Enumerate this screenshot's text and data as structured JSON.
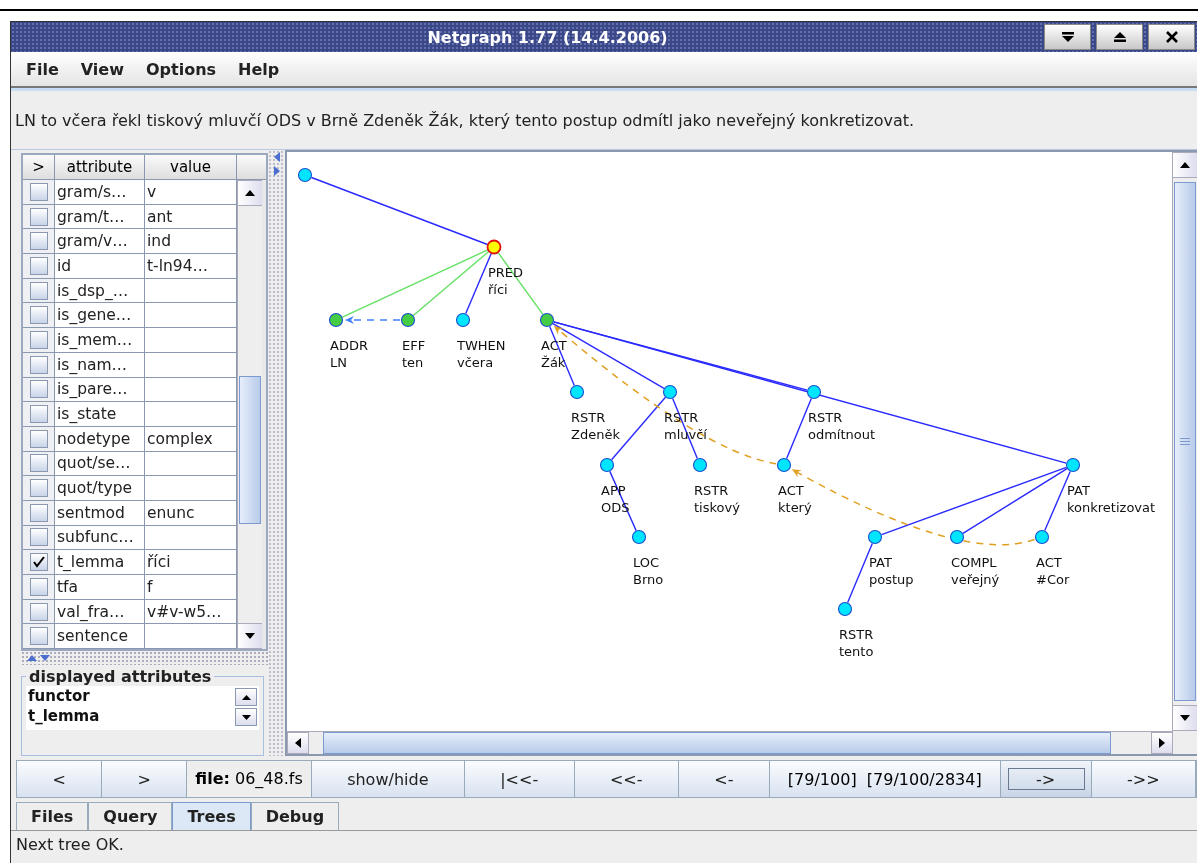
{
  "window": {
    "title": "Netgraph 1.77 (14.4.2006)"
  },
  "menu": [
    "File",
    "View",
    "Options",
    "Help"
  ],
  "sentence": "LN to včera řekl tiskový mluvčí ODS v Brně Zdeněk Žák, který tento postup odmítl jako neveřejný konkretizovat.",
  "attributes_table": {
    "columns": [
      ">",
      "attribute",
      "value"
    ],
    "rows": [
      {
        "checked": false,
        "attribute": "gram/s…",
        "value": "v"
      },
      {
        "checked": false,
        "attribute": "gram/t…",
        "value": "ant"
      },
      {
        "checked": false,
        "attribute": "gram/v…",
        "value": "ind"
      },
      {
        "checked": false,
        "attribute": "id",
        "value": "t-ln94…"
      },
      {
        "checked": false,
        "attribute": "is_dsp_…"
      },
      {
        "checked": false,
        "attribute": "is_gene…"
      },
      {
        "checked": false,
        "attribute": "is_mem…"
      },
      {
        "checked": false,
        "attribute": "is_nam…"
      },
      {
        "checked": false,
        "attribute": "is_pare…"
      },
      {
        "checked": false,
        "attribute": "is_state"
      },
      {
        "checked": false,
        "attribute": "nodetype",
        "value": "complex"
      },
      {
        "checked": false,
        "attribute": "quot/se…"
      },
      {
        "checked": false,
        "attribute": "quot/type"
      },
      {
        "checked": false,
        "attribute": "sentmod",
        "value": "enunc"
      },
      {
        "checked": false,
        "attribute": "subfunc…"
      },
      {
        "checked": true,
        "attribute": "t_lemma",
        "value": "říci"
      },
      {
        "checked": false,
        "attribute": "tfa",
        "value": "f"
      },
      {
        "checked": false,
        "attribute": "val_fra…",
        "value": "v#v-w5…"
      },
      {
        "checked": false,
        "attribute": "sentence"
      }
    ]
  },
  "displayed_attributes": {
    "title": "displayed attributes",
    "items": [
      "functor",
      "t_lemma"
    ]
  },
  "tree": {
    "root": {
      "color": "#00e5ff",
      "selected": false,
      "children": [
        {
          "functor": "PRED",
          "t_lemma": "říci",
          "color": "#ffff00",
          "selected": true,
          "edge": {
            "color": "#2a2aff"
          },
          "children": [
            {
              "functor": "ADDR",
              "t_lemma": "LN",
              "color": "#44cc44",
              "selected": false,
              "edge": {
                "color": "#66e066"
              }
            },
            {
              "functor": "EFF",
              "t_lemma": "ten",
              "color": "#44cc44",
              "selected": false,
              "edge": {
                "color": "#66e066"
              }
            },
            {
              "functor": "TWHEN",
              "t_lemma": "včera",
              "color": "#00e5ff",
              "selected": false,
              "edge": {
                "color": "#2a2aff"
              }
            },
            {
              "functor": "ACT",
              "t_lemma": "Žák",
              "color": "#44cc44",
              "selected": false,
              "edge": {
                "color": "#66e066"
              },
              "children": [
                {
                  "functor": "RSTR",
                  "t_lemma": "Zdeněk",
                  "color": "#00e5ff",
                  "selected": false,
                  "edge": {
                    "color": "#2a2aff"
                  }
                },
                {
                  "functor": "RSTR",
                  "t_lemma": "mluvčí",
                  "color": "#00e5ff",
                  "selected": false,
                  "edge": {
                    "color": "#2a2aff"
                  },
                  "children": [
                    {
                      "functor": "APP",
                      "t_lemma": "ODS",
                      "color": "#00e5ff",
                      "selected": false,
                      "edge": {
                        "color": "#2a2aff"
                      },
                      "children": [
                        {
                          "functor": "LOC",
                          "t_lemma": "Brno",
                          "color": "#00e5ff",
                          "selected": false,
                          "edge": {
                            "color": "#2a2aff"
                          }
                        }
                      ]
                    },
                    {
                      "functor": "RSTR",
                      "t_lemma": "tiskový",
                      "color": "#00e5ff",
                      "selected": false,
                      "edge": {
                        "color": "#2a2aff"
                      }
                    }
                  ]
                },
                {
                  "functor": "RSTR",
                  "t_lemma": "odmítnout",
                  "color": "#00e5ff",
                  "selected": false,
                  "edge": {
                    "color": "#2a2aff"
                  },
                  "children": [
                    {
                      "functor": "ACT",
                      "t_lemma": "který",
                      "color": "#00e5ff",
                      "selected": false,
                      "edge": {
                        "color": "#2a2aff"
                      }
                    }
                  ]
                },
                {
                  "functor": "PAT",
                  "t_lemma": "konkretizovat",
                  "color": "#00e5ff",
                  "selected": false,
                  "edge": {
                    "color": "#2a2aff"
                  },
                  "children": [
                    {
                      "functor": "PAT",
                      "t_lemma": "postup",
                      "color": "#00e5ff",
                      "selected": false,
                      "edge": {
                        "color": "#2a2aff"
                      },
                      "children": [
                        {
                          "functor": "RSTR",
                          "t_lemma": "tento",
                          "color": "#00e5ff",
                          "selected": false,
                          "edge": {
                            "color": "#2a2aff"
                          }
                        }
                      ]
                    },
                    {
                      "functor": "COMPL",
                      "t_lemma": "veřejný",
                      "color": "#00e5ff",
                      "selected": false,
                      "edge": {
                        "color": "#2a2aff"
                      }
                    },
                    {
                      "functor": "ACT",
                      "t_lemma": "#Cor",
                      "color": "#00e5ff",
                      "selected": false,
                      "edge": {
                        "color": "#2a2aff"
                      }
                    }
                  ]
                }
              ]
            }
          ]
        }
      ]
    },
    "arrows": [
      {
        "kind": "grammatical"
      },
      {
        "kind": "textual"
      },
      {
        "kind": "textual"
      }
    ]
  },
  "navigation": [
    {
      "kind": "button",
      "label": "<",
      "focused": false
    },
    {
      "kind": "button",
      "label": ">",
      "focused": false
    },
    {
      "kind": "file",
      "label": "**file:** 06_48.fs"
    },
    {
      "kind": "button",
      "label": "show/hide",
      "focused": false
    },
    {
      "kind": "button",
      "label": "|<<-",
      "focused": false
    },
    {
      "kind": "button",
      "label": "<<-",
      "focused": false
    },
    {
      "kind": "button",
      "label": "<-",
      "focused": false
    },
    {
      "kind": "position",
      "label": "[79/100]  [79/100/2834]"
    },
    {
      "kind": "button",
      "label": "->",
      "focused": true
    },
    {
      "kind": "button",
      "label": "->>",
      "focused": false
    }
  ],
  "tabs": [
    {
      "label": "Files",
      "selected": false
    },
    {
      "label": "Query",
      "selected": false
    },
    {
      "label": "Trees",
      "selected": true
    },
    {
      "label": "Debug",
      "selected": false
    }
  ],
  "status_bar": "Next tree OK."
}
